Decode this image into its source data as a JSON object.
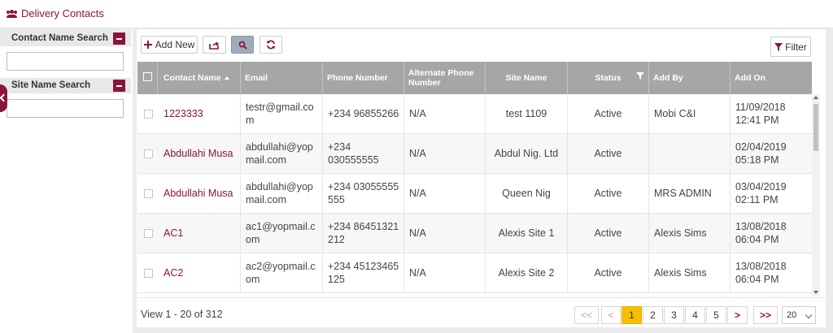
{
  "page": {
    "title": "Delivery Contacts",
    "icon": "users-icon"
  },
  "sidebar": {
    "contact_search": {
      "label": "Contact Name Search",
      "value": ""
    },
    "site_search": {
      "label": "Site Name Search",
      "value": ""
    }
  },
  "toolbar": {
    "add_label": "Add New",
    "filter_label": "Filter"
  },
  "table": {
    "columns": [
      "Contact Name",
      "Email",
      "Phone Number",
      "Alternate Phone Number",
      "Site Name",
      "Status",
      "Add By",
      "Add On"
    ],
    "rows": [
      {
        "name": "1223333",
        "email": "testr@gmail.com",
        "phone": "+234 96855266",
        "alt": "N/A",
        "site": "test 1109",
        "status": "Active",
        "by": "Mobi C&I",
        "on": "11/09/2018 12:41 PM"
      },
      {
        "name": "Abdullahi Musa",
        "email": "abdullahi@yopmail.com",
        "phone": "+234 030555555",
        "alt": "N/A",
        "site": "Abdul Nig. Ltd",
        "status": "Active",
        "by": "",
        "on": "02/04/2019 05:18 PM"
      },
      {
        "name": "Abdullahi Musa",
        "email": "abdullahi@yopmail.com",
        "phone": "+234 03055555555",
        "alt": "N/A",
        "site": "Queen Nig",
        "status": "Active",
        "by": "MRS ADMIN",
        "on": "03/04/2019 02:11 PM"
      },
      {
        "name": "AC1",
        "email": "ac1@yopmail.com",
        "phone": "+234 86451321212",
        "alt": "N/A",
        "site": "Alexis Site 1",
        "status": "Active",
        "by": "Alexis Sims",
        "on": "13/08/2018 06:04 PM"
      },
      {
        "name": "AC2",
        "email": "ac2@yopmail.com",
        "phone": "+234 45123465125",
        "alt": "N/A",
        "site": "Alexis Site 2",
        "status": "Active",
        "by": "Alexis Sims",
        "on": "13/08/2018 06:04 PM"
      }
    ]
  },
  "footer": {
    "view_text": "View 1 - 20 of 312",
    "first": "<<",
    "prev": "<",
    "pages": [
      "1",
      "2",
      "3",
      "4",
      "5"
    ],
    "current_page": "1",
    "next": ">",
    "last": ">>",
    "per_page": "20"
  },
  "colors": {
    "accent": "#8b1538",
    "header_bg": "#a6a6a6",
    "current_page": "#f5c000"
  }
}
